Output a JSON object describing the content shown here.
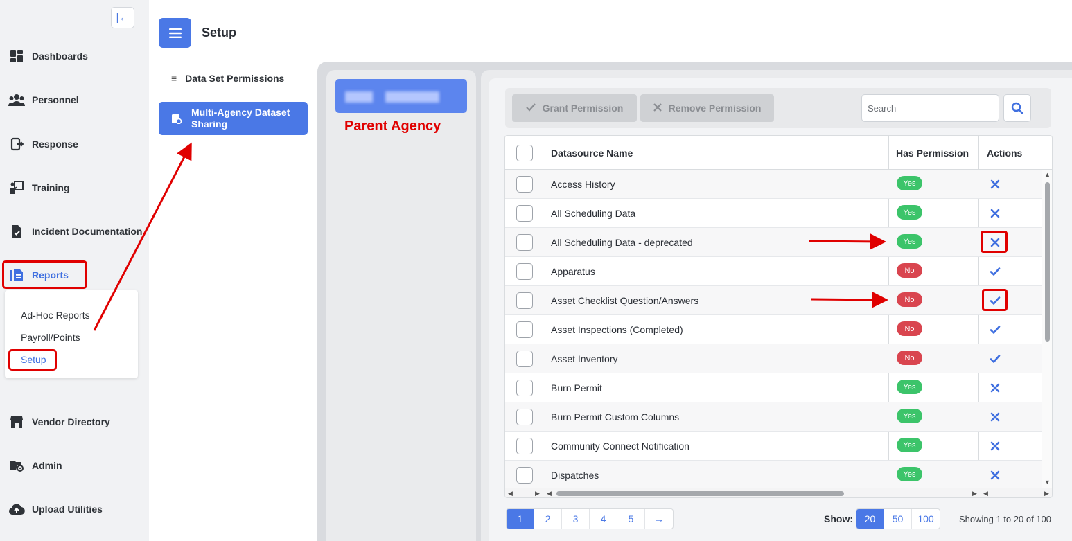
{
  "sidebar": {
    "collapse_icon": "collapse-left-icon",
    "items": [
      {
        "label": "Dashboards",
        "icon": "dashboard-icon"
      },
      {
        "label": "Personnel",
        "icon": "people-icon"
      },
      {
        "label": "Response",
        "icon": "response-icon"
      },
      {
        "label": "Training",
        "icon": "training-icon"
      },
      {
        "label": "Incident Documentation",
        "icon": "document-check-icon"
      },
      {
        "label": "Reports",
        "icon": "report-icon",
        "active": true
      },
      {
        "label": "Vendor Directory",
        "icon": "store-icon"
      },
      {
        "label": "Admin",
        "icon": "folder-gear-icon"
      },
      {
        "label": "Upload Utilities",
        "icon": "cloud-upload-icon"
      }
    ],
    "reports_submenu": [
      "Ad-Hoc Reports",
      "Payroll/Points",
      "Setup"
    ],
    "reports_submenu_active": "Setup"
  },
  "header": {
    "title": "Setup",
    "menu_icon": "hamburger-icon"
  },
  "subnav": {
    "items": [
      "Data Set Permissions",
      "Multi-Agency Dataset Sharing"
    ],
    "active": "Multi-Agency Dataset Sharing"
  },
  "agency_panel": {
    "annotation": "Parent Agency"
  },
  "toolbar": {
    "grant_label": "Grant Permission",
    "remove_label": "Remove Permission",
    "search_placeholder": "Search"
  },
  "table": {
    "headers": [
      "Datasource Name",
      "Has Permission",
      "Actions"
    ],
    "rows": [
      {
        "name": "Access History",
        "has_permission": "Yes",
        "action": "remove"
      },
      {
        "name": "All Scheduling Data",
        "has_permission": "Yes",
        "action": "remove"
      },
      {
        "name": "All Scheduling Data - deprecated",
        "has_permission": "Yes",
        "action": "remove"
      },
      {
        "name": "Apparatus",
        "has_permission": "No",
        "action": "grant"
      },
      {
        "name": "Asset Checklist Question/Answers",
        "has_permission": "No",
        "action": "grant"
      },
      {
        "name": "Asset Inspections (Completed)",
        "has_permission": "No",
        "action": "grant"
      },
      {
        "name": "Asset Inventory",
        "has_permission": "No",
        "action": "grant"
      },
      {
        "name": "Burn Permit",
        "has_permission": "Yes",
        "action": "remove"
      },
      {
        "name": "Burn Permit Custom Columns",
        "has_permission": "Yes",
        "action": "remove"
      },
      {
        "name": "Community Connect Notification",
        "has_permission": "Yes",
        "action": "remove"
      },
      {
        "name": "Dispatches",
        "has_permission": "Yes",
        "action": "remove"
      }
    ]
  },
  "pagination": {
    "pages": [
      "1",
      "2",
      "3",
      "4",
      "5",
      "→"
    ],
    "current": "1",
    "show_label": "Show:",
    "page_sizes": [
      "20",
      "50",
      "100"
    ],
    "page_size": "20",
    "showing_text": "Showing 1 to 20 of 100"
  },
  "colors": {
    "accent": "#4a78e6",
    "yes": "#3cc46a",
    "no": "#d9454f",
    "annotation": "#e00000"
  }
}
